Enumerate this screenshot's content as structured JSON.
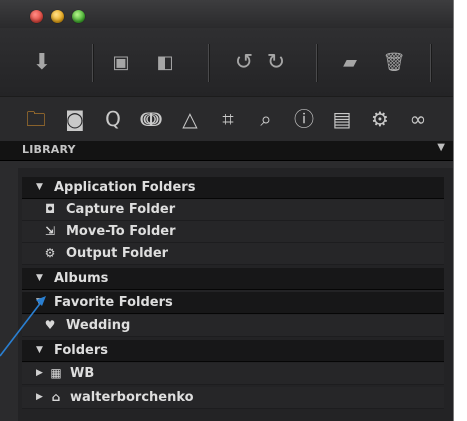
{
  "window": {
    "controls": [
      "close",
      "minimize",
      "zoom"
    ]
  },
  "toolbar": {
    "buttons": [
      {
        "name": "import-icon",
        "glyph": "⬇"
      },
      {
        "name": "browser-icon",
        "glyph": "▣"
      },
      {
        "name": "viewer-icon",
        "glyph": "◧"
      },
      {
        "name": "rotate-left-icon",
        "glyph": "↺"
      },
      {
        "name": "rotate-right-icon",
        "glyph": "↻"
      },
      {
        "name": "move-icon",
        "glyph": "▰"
      },
      {
        "name": "trash-icon",
        "glyph": "🗑"
      }
    ]
  },
  "tool_tabs": [
    {
      "name": "library",
      "glyph": "🗀"
    },
    {
      "name": "capture",
      "glyph": "◙"
    },
    {
      "name": "lens",
      "glyph": "Q"
    },
    {
      "name": "color",
      "glyph": "ↈ"
    },
    {
      "name": "exposure",
      "glyph": "△"
    },
    {
      "name": "crop",
      "glyph": "⌗"
    },
    {
      "name": "details",
      "glyph": "⌕"
    },
    {
      "name": "metadata",
      "glyph": "ⓘ"
    },
    {
      "name": "output",
      "glyph": "▤"
    },
    {
      "name": "adjustments",
      "glyph": "⚙"
    },
    {
      "name": "batch",
      "glyph": "∞"
    }
  ],
  "library": {
    "title": "LIBRARY"
  },
  "sections": {
    "application_folders": {
      "label": "Application Folders",
      "items": [
        "Capture Folder",
        "Move-To Folder",
        "Output Folder"
      ]
    },
    "albums": {
      "label": "Albums"
    },
    "favorite_folders": {
      "label": "Favorite Folders",
      "items": [
        "Wedding"
      ]
    },
    "folders": {
      "label": "Folders",
      "items": [
        "WB",
        "walterborchenko"
      ]
    }
  },
  "colors": {
    "accent": "#e89a2c",
    "annotation_arrow": "#2a7fd1"
  }
}
